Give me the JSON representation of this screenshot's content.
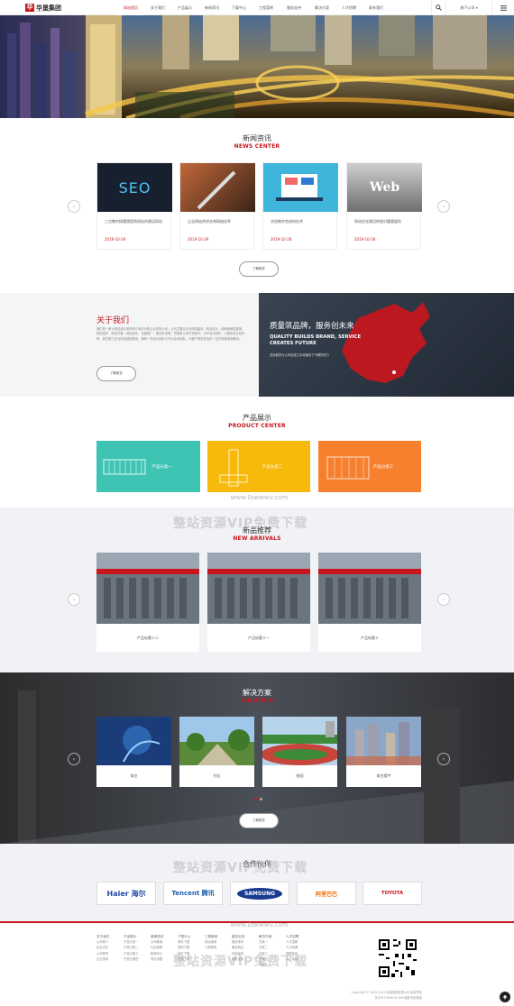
{
  "header": {
    "logo_mark": "华",
    "logo_text": "华垦集团",
    "logo_sub": "HUAKEN GROUP",
    "nav": [
      "网站首页",
      "关于我们",
      "产品展示",
      "新闻资讯",
      "下载中心",
      "工程案例",
      "服务支持",
      "解决方案",
      "人才招聘",
      "联系我们"
    ],
    "site_label": "旗下公司",
    "site_chevron": "▾",
    "search_icon": "search-icon",
    "menu_icon": "menu-icon"
  },
  "news": {
    "title_cn": "新闻资讯",
    "title_en": "NEWS CENTER",
    "items": [
      {
        "thumb": "SEO",
        "title": "三点教你搞懂猎医院网站的建设网站",
        "date": "2019-10-29"
      },
      {
        "thumb": "",
        "title": "企业网站的排名和网络化率",
        "date": "2019-10-29"
      },
      {
        "thumb": "",
        "title": "文档制作完成的技术",
        "date": "2019-10-28"
      },
      {
        "thumb": "Web",
        "title": "网站优化建设的相对重要级别",
        "date": "2019-10-28"
      }
    ],
    "more": "了解更多",
    "prev": "‹",
    "next": "›"
  },
  "about": {
    "title": "关于我们",
    "body": "我们是一家以网站设计制作和IT培训为核心业务的公司，公司主要业务为网站建设、网站设计、品牌营销型建网、网站维护、网站托管、网站优化、百度推广、微信开发等，凭借着公司开发制作、APP设计制作、小程序设计制作等，我们致力企业网站建设服务，拥有一流设计团队与专业技术团队，为客户提供完善的一站式网络营销服务。",
    "more": "了解更多",
    "banner_cn": "质量筑品牌，服务创未来",
    "banner_en1": "QUALITY BUILDS BRAND, SERVICE",
    "banner_en2": "CREATES FUTURE",
    "banner_sub": "坚持服务为公司经营之本将做到了不懈的努力"
  },
  "products": {
    "title_cn": "产品展示",
    "title_en": "PRODUCT CENTER",
    "items": [
      {
        "label": "产品分类一",
        "color": "#3fc4b4"
      },
      {
        "label": "产品分类二",
        "color": "#f7b90c"
      },
      {
        "label": "产品分类三",
        "color": "#f6802e"
      }
    ]
  },
  "watermarks": {
    "site": "www.0ɪwwwv.com",
    "text": "整站资源VIP免费下载"
  },
  "new_arrivals": {
    "title_cn": "新品推荐",
    "title_en": "NEW ARRIVALS",
    "items": [
      "产品标题十二",
      "产品标题十一",
      "产品标题十"
    ],
    "prev": "‹",
    "next": "›"
  },
  "solution": {
    "title_cn": "解决方案",
    "title_en": "SOLUTION",
    "items": [
      "商业",
      "社区",
      "校园",
      "商业楼宇"
    ],
    "more": "了解更多",
    "prev": "‹",
    "next": "›"
  },
  "partners": {
    "title_cn": "合作伙伴",
    "items": [
      "Haier 海尔",
      "Tencent 腾讯",
      "SAMSUNG",
      "阿里巴巴",
      "TOYOTA"
    ]
  },
  "footer": {
    "columns": [
      {
        "head": "关于我们",
        "links": [
          "公司简介",
          "企业文化",
          "公司荣誉",
          "企业风采"
        ]
      },
      {
        "head": "产品展示",
        "links": [
          "产品分类一",
          "产品分类二",
          "产品分类三",
          "产品分类四"
        ]
      },
      {
        "head": "新闻资讯",
        "links": [
          "公司新闻",
          "行业新闻",
          "新闻中心",
          "常见问题"
        ]
      },
      {
        "head": "下载中心",
        "links": [
          "资料下载",
          "常用下载",
          "软件下载",
          "文档下载"
        ]
      },
      {
        "head": "工程案例",
        "links": [
          "成功案例",
          "工程案例"
        ]
      },
      {
        "head": "服务支持",
        "links": [
          "服务体系",
          "服务网点",
          "在线留言",
          "服务支持"
        ]
      },
      {
        "head": "解决方案",
        "links": [
          "方案一",
          "方案二",
          "方案三",
          "方案四",
          "方案五"
        ]
      },
      {
        "head": "人才招聘",
        "links": [
          "人才招聘",
          "人力资源",
          "招聘信息",
          "人才培训"
        ]
      }
    ],
    "copyright": "Copyright © 2002-2019 某某集团有限公司 版权所有",
    "icp": "苏ICP12345678 XML地图 网站模板",
    "qr_icon": "qr-code-icon",
    "top_icon": "arrow-up-icon"
  }
}
